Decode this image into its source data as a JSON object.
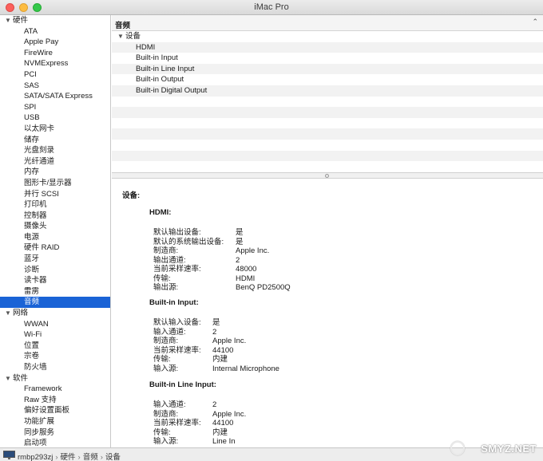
{
  "window": {
    "title": "iMac Pro"
  },
  "sidebar": {
    "groups": [
      {
        "label": "硬件",
        "items": [
          "ATA",
          "Apple Pay",
          "FireWire",
          "NVMExpress",
          "PCI",
          "SAS",
          "SATA/SATA Express",
          "SPI",
          "USB",
          "以太网卡",
          "储存",
          "光盘刻录",
          "光纤通道",
          "内存",
          "图形卡/显示器",
          "并行 SCSI",
          "打印机",
          "控制器",
          "摄像头",
          "电源",
          "硬件 RAID",
          "蓝牙",
          "诊断",
          "读卡器",
          "雷雳",
          "音频"
        ]
      },
      {
        "label": "网络",
        "items": [
          "WWAN",
          "Wi-Fi",
          "位置",
          "宗卷",
          "防火墙"
        ]
      },
      {
        "label": "软件",
        "items": [
          "Framework",
          "Raw 支持",
          "偏好设置面板",
          "功能扩展",
          "同步服务",
          "启动项"
        ]
      }
    ],
    "selected": "音频"
  },
  "header": {
    "label": "音频"
  },
  "top_list": {
    "group": "设备",
    "items": [
      "HDMI",
      "Built-in Input",
      "Built-in Line Input",
      "Built-in Output",
      "Built-in Digital Output"
    ]
  },
  "detail": {
    "title": "设备:",
    "sections": [
      {
        "heading": "HDMI:",
        "props": [
          {
            "k": "默认输出设备:",
            "v": "是"
          },
          {
            "k": "默认的系统输出设备:",
            "v": "是"
          },
          {
            "k": "制造商:",
            "v": "Apple Inc."
          },
          {
            "k": "输出通道:",
            "v": "2"
          },
          {
            "k": "当前采样速率:",
            "v": "48000"
          },
          {
            "k": "传输:",
            "v": "HDMI"
          },
          {
            "k": "输出源:",
            "v": "BenQ PD2500Q"
          }
        ]
      },
      {
        "heading": "Built-in Input:",
        "props": [
          {
            "k": "默认输入设备:",
            "v": "是"
          },
          {
            "k": "输入通道:",
            "v": "2"
          },
          {
            "k": "制造商:",
            "v": "Apple Inc."
          },
          {
            "k": "当前采样速率:",
            "v": "44100"
          },
          {
            "k": "传输:",
            "v": "内建"
          },
          {
            "k": "输入源:",
            "v": "Internal Microphone"
          }
        ]
      },
      {
        "heading": "Built-in Line Input:",
        "props": [
          {
            "k": "输入通道:",
            "v": "2"
          },
          {
            "k": "制造商:",
            "v": "Apple Inc."
          },
          {
            "k": "当前采样速率:",
            "v": "44100"
          },
          {
            "k": "传输:",
            "v": "内建"
          },
          {
            "k": "输入源:",
            "v": "Line In"
          }
        ]
      }
    ]
  },
  "statusbar": {
    "path": [
      "rmbp293zj",
      "硬件",
      "音频",
      "设备"
    ],
    "separator": "›"
  },
  "watermark": {
    "text": "SMYZ.NET"
  },
  "colors": {
    "selection": "#1a63d6"
  }
}
